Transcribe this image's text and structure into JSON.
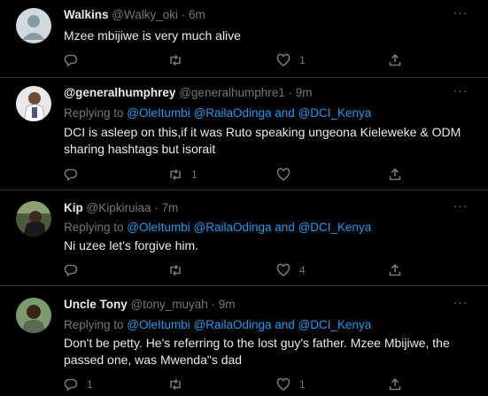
{
  "tweets": [
    {
      "name": "Walkins",
      "handle": "@Walky_oki",
      "time": "· 6m",
      "more": "···",
      "text": "Mzee mbijiwe is very much alive",
      "counts": {
        "reply": "",
        "retweet": "",
        "like": "1",
        "share": ""
      }
    },
    {
      "name": "@generalhumphrey",
      "handle": "@generalhumphre1",
      "time": "· 9m",
      "more": "···",
      "replying": {
        "prefix": "Replying to ",
        "mentions": "@OleItumbi @RailaOdinga",
        "and": " and ",
        "last": "@DCI_Kenya"
      },
      "text": "DCI is asleep on this,if it was Ruto speaking ungeona Kieleweke & ODM sharing hashtags but isorait",
      "counts": {
        "reply": "",
        "retweet": "1",
        "like": "",
        "share": ""
      }
    },
    {
      "name": "Kip",
      "handle": "@Kipkiruiaa",
      "time": "· 7m",
      "more": "···",
      "replying": {
        "prefix": "Replying to ",
        "mentions": "@OleItumbi @RailaOdinga",
        "and": " and ",
        "last": "@DCI_Kenya"
      },
      "text": "Ni uzee let's forgive him.",
      "counts": {
        "reply": "",
        "retweet": "",
        "like": "4",
        "share": ""
      }
    },
    {
      "name": "Uncle Tony",
      "handle": "@tony_muyah",
      "time": "· 9m",
      "more": "···",
      "replying": {
        "prefix": "Replying to ",
        "mentions": "@OleItumbi @RailaOdinga",
        "and": " and ",
        "last": "@DCI_Kenya"
      },
      "text": "Don't be petty. He's referring to the lost guy's father. Mzee Mbijiwe, the passed one, was Mwenda\"s dad",
      "counts": {
        "reply": "1",
        "retweet": "",
        "like": "1",
        "share": ""
      }
    }
  ]
}
